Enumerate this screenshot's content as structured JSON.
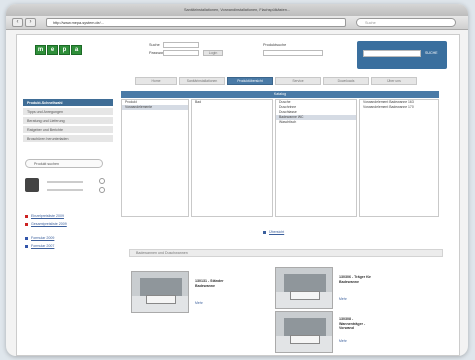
{
  "browser": {
    "title": "Sanitärinstallationen, Vorwandinstallationen, Flachspülkästen...",
    "url": "http://www.mepa-system.de/...",
    "search_placeholder": "Suche",
    "back_icon": "back-arrow-icon",
    "forward_icon": "forward-arrow-icon"
  },
  "header": {
    "logo_letters": [
      "m",
      "e",
      "p",
      "a"
    ],
    "field1_label": "Suche",
    "field2_label": "Passwort",
    "button_label": "Login",
    "search_label": "Produktsuche",
    "search_button": "SUCHE"
  },
  "tabs": [
    "Home",
    "Sanitärinstallationen",
    "Produktübersicht",
    "Service",
    "Downloads",
    "Über uns"
  ],
  "sidebar": {
    "items": [
      "Produkt-Schnellwahl",
      "Tipps und Anregungen",
      "Beratung und Lieferung",
      "Ratgeber und Berichte",
      "Broschüren herunterladen"
    ],
    "pill_label": "Produkt suchen",
    "links": [
      "Einzelpreisliste 2009",
      "Gesamtpreisliste 2009",
      "Formular 2009",
      "Formular 2007"
    ]
  },
  "columns": {
    "header": "Katalog",
    "col1": [
      "Produkt",
      "Vorwandelemente"
    ],
    "col2": [
      "Bad"
    ],
    "col3": [
      "Dusche",
      "Duschrinne",
      "Duschtasse",
      "Badewanne WC",
      "Waschtisch"
    ],
    "col4": [
      "Vorwandelement Badewanne 163",
      "Vorwandelement Badewanne 170"
    ]
  },
  "section": {
    "link": "Übersicht",
    "bar": "Badewannen und Duschwannen"
  },
  "products": [
    {
      "title": "130131 - Ständer Badewanne",
      "more": "Mehr"
    },
    {
      "title": "130306 - Träger für Badewanne",
      "more": "Mehr"
    },
    {
      "title": "130308 - Wannenträger - Vorwand",
      "more": "Mehr"
    }
  ]
}
